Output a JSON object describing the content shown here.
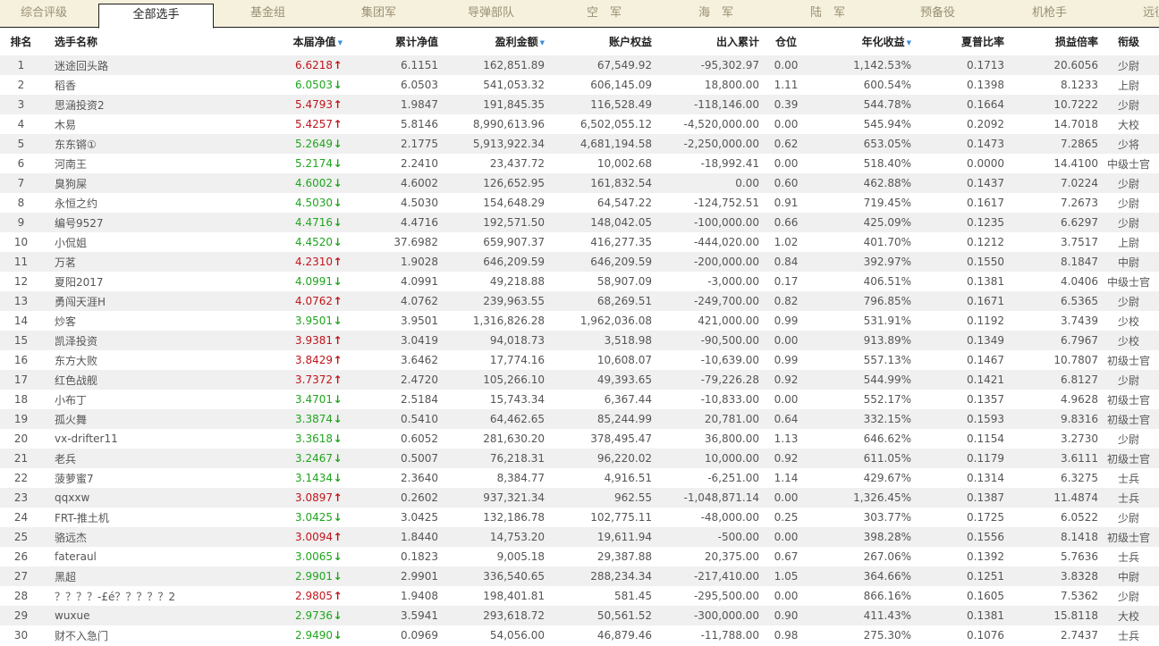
{
  "tabs": [
    {
      "label": "综合评级",
      "active": false
    },
    {
      "label": "全部选手",
      "active": true
    },
    {
      "label": "基金组",
      "active": false
    },
    {
      "label": "集团军",
      "active": false
    },
    {
      "label": "导弹部队",
      "active": false
    },
    {
      "label": "空　军",
      "active": false
    },
    {
      "label": "海　军",
      "active": false
    },
    {
      "label": "陆　军",
      "active": false
    },
    {
      "label": "预备役",
      "active": false
    },
    {
      "label": "机枪手",
      "active": false
    },
    {
      "label": "远征军",
      "active": false
    }
  ],
  "columns": [
    {
      "label": "排名",
      "sortable": false
    },
    {
      "label": "选手名称",
      "sortable": false
    },
    {
      "label": "本届净值",
      "sortable": true
    },
    {
      "label": "累计净值",
      "sortable": false
    },
    {
      "label": "盈利金额",
      "sortable": true
    },
    {
      "label": "账户权益",
      "sortable": false
    },
    {
      "label": "出入累计",
      "sortable": false
    },
    {
      "label": "仓位",
      "sortable": false
    },
    {
      "label": "年化收益",
      "sortable": true
    },
    {
      "label": "夏普比率",
      "sortable": false
    },
    {
      "label": "损益倍率",
      "sortable": false
    },
    {
      "label": "衔级",
      "sortable": false
    }
  ],
  "sort_icon": "sort-down-triangle-icon",
  "arrow_icons": {
    "up": "arrow-up-icon",
    "down": "arrow-down-icon"
  },
  "colors": {
    "up": "#c0141b",
    "down": "#1fa51d",
    "sort": "#3b8fd6"
  },
  "rows": [
    {
      "rank": "1",
      "name": "迷途回头路",
      "nav": "6.6218",
      "dir": "up",
      "cum": "6.1151",
      "profit": "162,851.89",
      "equity": "67,549.92",
      "flow": "-95,302.97",
      "pos": "0.00",
      "annual": "1,142.53%",
      "sharpe": "0.1713",
      "pl": "20.6056",
      "rank_title": "少尉"
    },
    {
      "rank": "2",
      "name": "稻香",
      "nav": "6.0503",
      "dir": "down",
      "cum": "6.0503",
      "profit": "541,053.32",
      "equity": "606,145.09",
      "flow": "18,800.00",
      "pos": "1.11",
      "annual": "600.54%",
      "sharpe": "0.1398",
      "pl": "8.1233",
      "rank_title": "上尉"
    },
    {
      "rank": "3",
      "name": "思涵投资2",
      "nav": "5.4793",
      "dir": "up",
      "cum": "1.9847",
      "profit": "191,845.35",
      "equity": "116,528.49",
      "flow": "-118,146.00",
      "pos": "0.39",
      "annual": "544.78%",
      "sharpe": "0.1664",
      "pl": "10.7222",
      "rank_title": "少尉"
    },
    {
      "rank": "4",
      "name": "木易",
      "nav": "5.4257",
      "dir": "up",
      "cum": "5.8146",
      "profit": "8,990,613.96",
      "equity": "6,502,055.12",
      "flow": "-4,520,000.00",
      "pos": "0.00",
      "annual": "545.94%",
      "sharpe": "0.2092",
      "pl": "14.7018",
      "rank_title": "大校"
    },
    {
      "rank": "5",
      "name": "东东锵①",
      "nav": "5.2649",
      "dir": "down",
      "cum": "2.1775",
      "profit": "5,913,922.34",
      "equity": "4,681,194.58",
      "flow": "-2,250,000.00",
      "pos": "0.62",
      "annual": "653.05%",
      "sharpe": "0.1473",
      "pl": "7.2865",
      "rank_title": "少将"
    },
    {
      "rank": "6",
      "name": "河南王",
      "nav": "5.2174",
      "dir": "down",
      "cum": "2.2410",
      "profit": "23,437.72",
      "equity": "10,002.68",
      "flow": "-18,992.41",
      "pos": "0.00",
      "annual": "518.40%",
      "sharpe": "0.0000",
      "pl": "14.4100",
      "rank_title": "中级士官"
    },
    {
      "rank": "7",
      "name": "臭狗屎",
      "nav": "4.6002",
      "dir": "down",
      "cum": "4.6002",
      "profit": "126,652.95",
      "equity": "161,832.54",
      "flow": "0.00",
      "pos": "0.60",
      "annual": "462.88%",
      "sharpe": "0.1437",
      "pl": "7.0224",
      "rank_title": "少尉"
    },
    {
      "rank": "8",
      "name": "永恒之约",
      "nav": "4.5030",
      "dir": "down",
      "cum": "4.5030",
      "profit": "154,648.29",
      "equity": "64,547.22",
      "flow": "-124,752.51",
      "pos": "0.91",
      "annual": "719.45%",
      "sharpe": "0.1617",
      "pl": "7.2673",
      "rank_title": "少尉"
    },
    {
      "rank": "9",
      "name": "编号9527",
      "nav": "4.4716",
      "dir": "down",
      "cum": "4.4716",
      "profit": "192,571.50",
      "equity": "148,042.05",
      "flow": "-100,000.00",
      "pos": "0.66",
      "annual": "425.09%",
      "sharpe": "0.1235",
      "pl": "6.6297",
      "rank_title": "少尉"
    },
    {
      "rank": "10",
      "name": "小侃姐",
      "nav": "4.4520",
      "dir": "down",
      "cum": "37.6982",
      "profit": "659,907.37",
      "equity": "416,277.35",
      "flow": "-444,020.00",
      "pos": "1.02",
      "annual": "401.70%",
      "sharpe": "0.1212",
      "pl": "3.7517",
      "rank_title": "上尉"
    },
    {
      "rank": "11",
      "name": "万茗",
      "nav": "4.2310",
      "dir": "up",
      "cum": "1.9028",
      "profit": "646,209.59",
      "equity": "646,209.59",
      "flow": "-200,000.00",
      "pos": "0.84",
      "annual": "392.97%",
      "sharpe": "0.1550",
      "pl": "8.1847",
      "rank_title": "中尉"
    },
    {
      "rank": "12",
      "name": "夏阳2017",
      "nav": "4.0991",
      "dir": "down",
      "cum": "4.0991",
      "profit": "49,218.88",
      "equity": "58,907.09",
      "flow": "-3,000.00",
      "pos": "0.17",
      "annual": "406.51%",
      "sharpe": "0.1381",
      "pl": "4.0406",
      "rank_title": "中级士官"
    },
    {
      "rank": "13",
      "name": "勇闯天涯H",
      "nav": "4.0762",
      "dir": "up",
      "cum": "4.0762",
      "profit": "239,963.55",
      "equity": "68,269.51",
      "flow": "-249,700.00",
      "pos": "0.82",
      "annual": "796.85%",
      "sharpe": "0.1671",
      "pl": "6.5365",
      "rank_title": "少尉"
    },
    {
      "rank": "14",
      "name": "炒客",
      "nav": "3.9501",
      "dir": "down",
      "cum": "3.9501",
      "profit": "1,316,826.28",
      "equity": "1,962,036.08",
      "flow": "421,000.00",
      "pos": "0.99",
      "annual": "531.91%",
      "sharpe": "0.1192",
      "pl": "3.7439",
      "rank_title": "少校"
    },
    {
      "rank": "15",
      "name": "凯泽投资",
      "nav": "3.9381",
      "dir": "up",
      "cum": "3.0419",
      "profit": "94,018.73",
      "equity": "3,518.98",
      "flow": "-90,500.00",
      "pos": "0.00",
      "annual": "913.89%",
      "sharpe": "0.1349",
      "pl": "6.7967",
      "rank_title": "少校"
    },
    {
      "rank": "16",
      "name": "东方大败",
      "nav": "3.8429",
      "dir": "up",
      "cum": "3.6462",
      "profit": "17,774.16",
      "equity": "10,608.07",
      "flow": "-10,639.00",
      "pos": "0.99",
      "annual": "557.13%",
      "sharpe": "0.1467",
      "pl": "10.7807",
      "rank_title": "初级士官"
    },
    {
      "rank": "17",
      "name": "红色战舰",
      "nav": "3.7372",
      "dir": "up",
      "cum": "2.4720",
      "profit": "105,266.10",
      "equity": "49,393.65",
      "flow": "-79,226.28",
      "pos": "0.92",
      "annual": "544.99%",
      "sharpe": "0.1421",
      "pl": "6.8127",
      "rank_title": "少尉"
    },
    {
      "rank": "18",
      "name": "小布丁",
      "nav": "3.4701",
      "dir": "down",
      "cum": "2.5184",
      "profit": "15,743.34",
      "equity": "6,367.44",
      "flow": "-10,833.00",
      "pos": "0.00",
      "annual": "552.17%",
      "sharpe": "0.1357",
      "pl": "4.9628",
      "rank_title": "初级士官"
    },
    {
      "rank": "19",
      "name": "孤火舞",
      "nav": "3.3874",
      "dir": "down",
      "cum": "0.5410",
      "profit": "64,462.65",
      "equity": "85,244.99",
      "flow": "20,781.00",
      "pos": "0.64",
      "annual": "332.15%",
      "sharpe": "0.1593",
      "pl": "9.8316",
      "rank_title": "初级士官"
    },
    {
      "rank": "20",
      "name": "vx-drifter11",
      "nav": "3.3618",
      "dir": "down",
      "cum": "0.6052",
      "profit": "281,630.20",
      "equity": "378,495.47",
      "flow": "36,800.00",
      "pos": "1.13",
      "annual": "646.62%",
      "sharpe": "0.1154",
      "pl": "3.2730",
      "rank_title": "少尉"
    },
    {
      "rank": "21",
      "name": "老兵",
      "nav": "3.2467",
      "dir": "down",
      "cum": "0.5007",
      "profit": "76,218.31",
      "equity": "96,220.02",
      "flow": "10,000.00",
      "pos": "0.92",
      "annual": "611.05%",
      "sharpe": "0.1179",
      "pl": "3.6111",
      "rank_title": "初级士官"
    },
    {
      "rank": "22",
      "name": "菠萝蜜7",
      "nav": "3.1434",
      "dir": "down",
      "cum": "2.3640",
      "profit": "8,384.77",
      "equity": "4,916.51",
      "flow": "-6,251.00",
      "pos": "1.14",
      "annual": "429.67%",
      "sharpe": "0.1314",
      "pl": "6.3275",
      "rank_title": "士兵"
    },
    {
      "rank": "23",
      "name": "qqxxw",
      "nav": "3.0897",
      "dir": "up",
      "cum": "0.2602",
      "profit": "937,321.34",
      "equity": "962.55",
      "flow": "-1,048,871.14",
      "pos": "0.00",
      "annual": "1,326.45%",
      "sharpe": "0.1387",
      "pl": "11.4874",
      "rank_title": "士兵"
    },
    {
      "rank": "24",
      "name": "FRT-推土机",
      "nav": "3.0425",
      "dir": "down",
      "cum": "3.0425",
      "profit": "132,186.78",
      "equity": "102,775.11",
      "flow": "-48,000.00",
      "pos": "0.25",
      "annual": "303.77%",
      "sharpe": "0.1725",
      "pl": "6.0522",
      "rank_title": "少尉"
    },
    {
      "rank": "25",
      "name": "骆远杰",
      "nav": "3.0094",
      "dir": "up",
      "cum": "1.8440",
      "profit": "14,753.20",
      "equity": "19,611.94",
      "flow": "-500.00",
      "pos": "0.00",
      "annual": "398.28%",
      "sharpe": "0.1556",
      "pl": "8.1418",
      "rank_title": "初级士官"
    },
    {
      "rank": "26",
      "name": "fateraul",
      "nav": "3.0065",
      "dir": "down",
      "cum": "0.1823",
      "profit": "9,005.18",
      "equity": "29,387.88",
      "flow": "20,375.00",
      "pos": "0.67",
      "annual": "267.06%",
      "sharpe": "0.1392",
      "pl": "5.7636",
      "rank_title": "士兵"
    },
    {
      "rank": "27",
      "name": "黑超",
      "nav": "2.9901",
      "dir": "down",
      "cum": "2.9901",
      "profit": "336,540.65",
      "equity": "288,234.34",
      "flow": "-217,410.00",
      "pos": "1.05",
      "annual": "364.66%",
      "sharpe": "0.1251",
      "pl": "3.8328",
      "rank_title": "中尉"
    },
    {
      "rank": "28",
      "name": "？？？？-£é？？？？？2",
      "nav": "2.9805",
      "dir": "up",
      "cum": "1.9408",
      "profit": "198,401.81",
      "equity": "581.45",
      "flow": "-295,500.00",
      "pos": "0.00",
      "annual": "866.16%",
      "sharpe": "0.1605",
      "pl": "7.5362",
      "rank_title": "少尉"
    },
    {
      "rank": "29",
      "name": "wuxue",
      "nav": "2.9736",
      "dir": "down",
      "cum": "3.5941",
      "profit": "293,618.72",
      "equity": "50,561.52",
      "flow": "-300,000.00",
      "pos": "0.90",
      "annual": "411.43%",
      "sharpe": "0.1381",
      "pl": "15.8118",
      "rank_title": "大校"
    },
    {
      "rank": "30",
      "name": "财不入急门",
      "nav": "2.9490",
      "dir": "down",
      "cum": "0.0969",
      "profit": "54,056.00",
      "equity": "46,879.46",
      "flow": "-11,788.00",
      "pos": "0.98",
      "annual": "275.30%",
      "sharpe": "0.1076",
      "pl": "2.7437",
      "rank_title": "士兵"
    }
  ]
}
